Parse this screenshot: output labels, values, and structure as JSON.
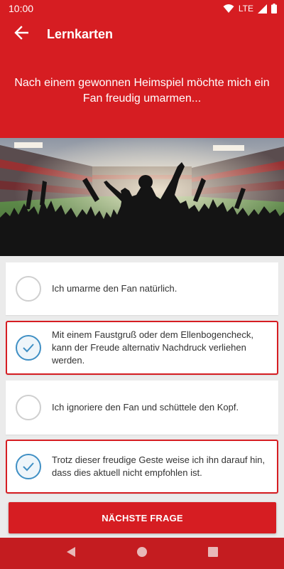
{
  "status_bar": {
    "time": "10:00",
    "network": "LTE"
  },
  "app_bar": {
    "title": "Lernkarten"
  },
  "question": {
    "text": "Nach einem gewonnen Heimspiel möchte mich ein Fan freudig umarmen..."
  },
  "answers": [
    {
      "text": "Ich umarme den Fan natürlich.",
      "selected": false
    },
    {
      "text": "Mit einem Faustgruß oder dem Ellenbogencheck, kann der Freude alternativ Nachdruck verliehen werden.",
      "selected": true
    },
    {
      "text": "Ich ignoriere den Fan und schüttele den Kopf.",
      "selected": false
    },
    {
      "text": "Trotz dieser freudige Geste weise ich ihn darauf hin, dass dies aktuell nicht empfohlen ist.",
      "selected": true
    }
  ],
  "next_button": {
    "label": "NÄCHSTE FRAGE"
  },
  "colors": {
    "primary": "#d61d22",
    "check": "#3f8fc4",
    "background": "#ebebeb"
  },
  "icons": {
    "back": "arrow-back-icon",
    "wifi": "wifi-icon",
    "signal": "signal-icon",
    "battery": "battery-icon",
    "check": "check-icon",
    "nav_back": "nav-back-icon",
    "nav_home": "nav-home-icon",
    "nav_recents": "nav-recents-icon"
  }
}
